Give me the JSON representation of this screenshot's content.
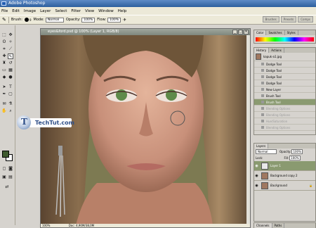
{
  "app": {
    "title": "Adobe Photoshop"
  },
  "menu": [
    "File",
    "Edit",
    "Image",
    "Layer",
    "Select",
    "Filter",
    "View",
    "Window",
    "Help"
  ],
  "options": {
    "brush_label": "Brush:",
    "brush_size": "9",
    "mode_label": "Mode:",
    "mode_value": "Normal",
    "opacity_label": "Opacity:",
    "opacity_value": "100%",
    "flow_label": "Flow:",
    "flow_value": "100%"
  },
  "wells": [
    "Brushes",
    "Presets",
    "Comps"
  ],
  "document": {
    "title": "eyes&ford.psd @ 100% (Layer 1, RGB/8)",
    "zoom": "100%",
    "doc_size": "Doc: 4,90M/38,0M"
  },
  "panels": {
    "color_tabs": [
      "Color",
      "Swatches",
      "Styles"
    ],
    "history_tabs": [
      "History",
      "Actions"
    ],
    "history_snapshot": "kapuk-a1.jpg",
    "history": [
      {
        "label": "Dodge Tool",
        "state": "normal"
      },
      {
        "label": "Dodge Tool",
        "state": "normal"
      },
      {
        "label": "Dodge Tool",
        "state": "normal"
      },
      {
        "label": "Dodge Tool",
        "state": "normal"
      },
      {
        "label": "New Layer",
        "state": "normal"
      },
      {
        "label": "Brush Tool",
        "state": "normal"
      },
      {
        "label": "Brush Tool",
        "state": "selected"
      },
      {
        "label": "Blending Options",
        "state": "dim"
      },
      {
        "label": "Blending Options",
        "state": "dim"
      },
      {
        "label": "Hue/Saturation",
        "state": "dim"
      },
      {
        "label": "Blending Options",
        "state": "dim"
      }
    ],
    "layers_tab": "Layers",
    "layer_mode": "Normal",
    "layer_opacity_label": "Opacity:",
    "layer_opacity": "100%",
    "lock_label": "Lock:",
    "fill_label": "Fill:",
    "fill_value": "100%",
    "layers": [
      {
        "name": "Layer 1",
        "selected": true
      },
      {
        "name": "Background copy 2",
        "selected": false
      },
      {
        "name": "Background",
        "selected": false
      }
    ],
    "bottom_tabs": [
      "Channels",
      "Paths"
    ]
  },
  "watermark": "TechTut.com",
  "colors": {
    "foreground": "#3e5a2e",
    "background": "#ffffff",
    "eye_paint": "#5f8a4a"
  }
}
